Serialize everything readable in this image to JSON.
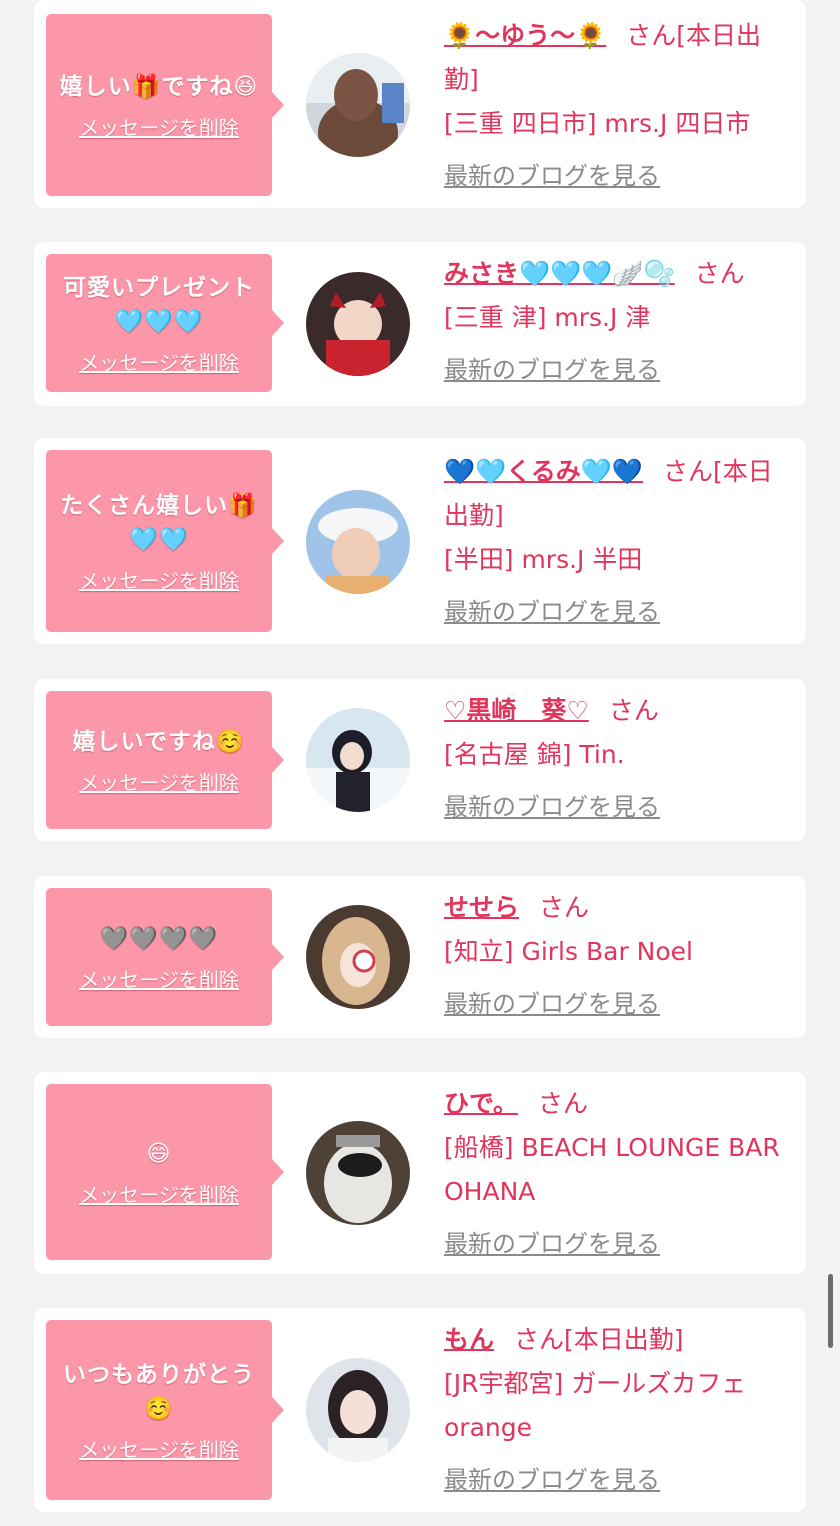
{
  "entries": [
    {
      "message": "嬉しい🎁ですね😆",
      "delete_label": "メッセージを削除",
      "name": "🌻〜ゆう〜🌻",
      "suffix": "さん[本日出勤]",
      "shop": "[三重 四日市] mrs.J 四日市",
      "blog_label": "最新のブログを見る"
    },
    {
      "message": "可愛いプレゼント🩵🩵🩵",
      "delete_label": "メッセージを削除",
      "name": "みさき🩵🩵🩵🪽🫧",
      "suffix": "さん",
      "shop": "[三重 津] mrs.J 津",
      "blog_label": "最新のブログを見る"
    },
    {
      "message": "たくさん嬉しい🎁🩵🩵",
      "delete_label": "メッセージを削除",
      "name": "💙🩵くるみ🩵💙",
      "suffix": "さん[本日出勤]",
      "shop": "[半田] mrs.J 半田",
      "blog_label": "最新のブログを見る"
    },
    {
      "message": "嬉しいですね☺️",
      "delete_label": "メッセージを削除",
      "name": "♡黒崎　葵♡",
      "suffix": "さん",
      "shop": "[名古屋 錦] Tin.",
      "blog_label": "最新のブログを見る"
    },
    {
      "message": "🩶🩶🩶🩶",
      "delete_label": "メッセージを削除",
      "name": "せせら",
      "suffix": "さん",
      "shop": "[知立] Girls Bar Noel",
      "blog_label": "最新のブログを見る"
    },
    {
      "message": "😄",
      "delete_label": "メッセージを削除",
      "name": "ひで。",
      "suffix": "さん",
      "shop": "[船橋] BEACH LOUNGE BAR OHANA",
      "blog_label": "最新のブログを見る"
    },
    {
      "message": "いつもありがとう☺️",
      "delete_label": "メッセージを削除",
      "name": "もん",
      "suffix": "さん[本日出勤]",
      "shop": "[JR宇都宮] ガールズカフェorange",
      "blog_label": "最新のブログを見る"
    }
  ],
  "colors": {
    "bubble": "#fb97a9",
    "accent": "#e0355c",
    "blog_link": "#8a8a8a",
    "background": "#f2f2f2"
  }
}
